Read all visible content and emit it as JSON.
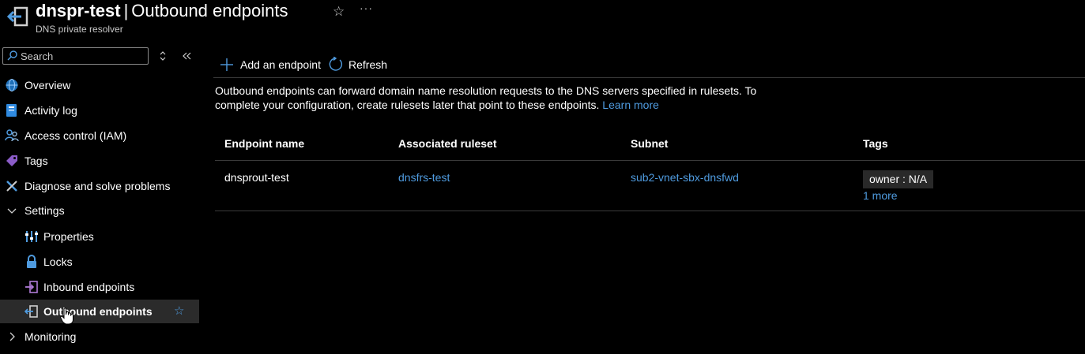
{
  "header": {
    "resource_name": "dnspr-test",
    "separator": "|",
    "page_name": "Outbound endpoints",
    "subtitle": "DNS private resolver",
    "favorite_glyph": "☆",
    "more_glyph": "···"
  },
  "sidebar": {
    "search": {
      "placeholder": "Search",
      "value": ""
    },
    "items": [
      {
        "label": "Overview",
        "icon": "overview-globe-icon"
      },
      {
        "label": "Activity log",
        "icon": "activity-log-icon"
      },
      {
        "label": "Access control (IAM)",
        "icon": "people-icon"
      },
      {
        "label": "Tags",
        "icon": "tag-icon"
      },
      {
        "label": "Diagnose and solve problems",
        "icon": "wrench-icon"
      },
      {
        "label": "Settings",
        "icon": "chevron-down-icon",
        "expanded": true
      },
      {
        "label": "Properties",
        "icon": "properties-icon"
      },
      {
        "label": "Locks",
        "icon": "lock-icon"
      },
      {
        "label": "Inbound endpoints",
        "icon": "inbound-endpoint-icon"
      },
      {
        "label": "Outbound endpoints",
        "icon": "outbound-endpoint-icon",
        "selected": true,
        "favorite": "☆"
      },
      {
        "label": "Monitoring",
        "icon": "chevron-right-icon",
        "expanded": false
      }
    ]
  },
  "toolbar": {
    "add_label": "Add an endpoint",
    "refresh_label": "Refresh"
  },
  "info": {
    "text": "Outbound endpoints can forward domain name resolution requests to the DNS servers specified in rulesets. To complete your configuration, create rulesets later that point to these endpoints.",
    "link": "Learn more"
  },
  "table": {
    "columns": [
      "Endpoint name",
      "Associated ruleset",
      "Subnet",
      "Tags"
    ],
    "rows": [
      {
        "endpoint_name": "dnsprout-test",
        "ruleset": "dnsfrs-test",
        "subnet": "sub2-vnet-sbx-dnsfwd",
        "tag": "owner : N/A",
        "more_tags": "1 more"
      }
    ]
  },
  "colors": {
    "background": "#000000",
    "accent": "#4f9bdf",
    "selected": "#2b2b2b",
    "divider": "#3a3a3a"
  }
}
